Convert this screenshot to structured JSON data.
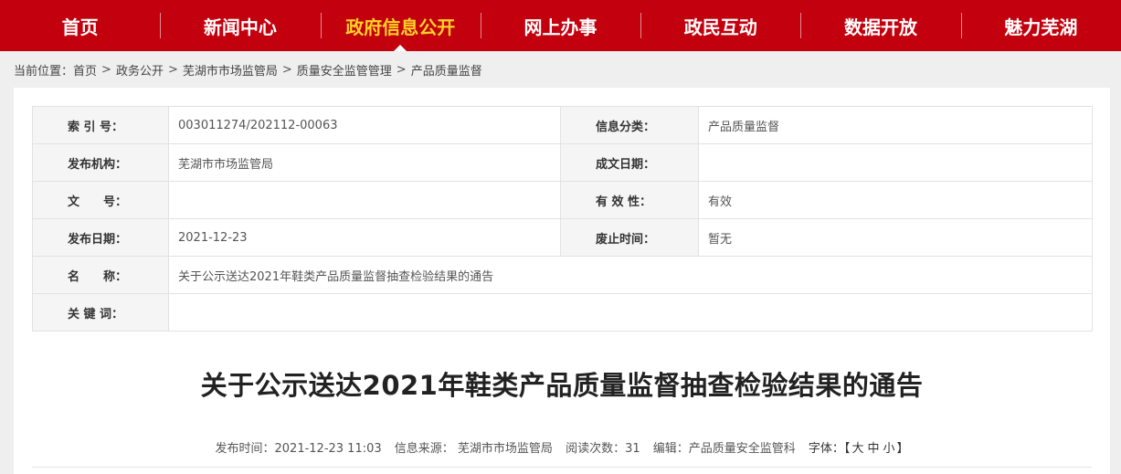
{
  "nav": {
    "items": [
      {
        "label": "首页",
        "active": false
      },
      {
        "label": "新闻中心",
        "active": false
      },
      {
        "label": "政府信息公开",
        "active": true
      },
      {
        "label": "网上办事",
        "active": false
      },
      {
        "label": "政民互动",
        "active": false
      },
      {
        "label": "数据开放",
        "active": false
      },
      {
        "label": "魅力芜湖",
        "active": false
      }
    ]
  },
  "breadcrumb": {
    "prefix": "当前位置：",
    "separator": ">",
    "items": [
      "首页",
      "政务公开",
      "芜湖市市场监管局",
      "质量安全监管管理",
      "产品质量监督"
    ]
  },
  "info": {
    "index_label": "索 引 号：",
    "index_value": "003011274/202112-00063",
    "category_label": "信息分类：",
    "category_value": "产品质量监督",
    "publisher_label": "发布机构：",
    "publisher_value": "芜湖市市场监管局",
    "written_date_label": "成文日期：",
    "written_date_value": "",
    "doc_no_label": "文　　号：",
    "doc_no_value": "",
    "validity_label": "有 效 性：",
    "validity_value": "有效",
    "publish_date_label": "发布日期：",
    "publish_date_value": "2021-12-23",
    "expiry_label": "废止时间：",
    "expiry_value": "暂无",
    "name_label": "名　　称：",
    "name_value": "关于公示送达2021年鞋类产品质量监督抽查检验结果的通告",
    "keywords_label": "关 键 词：",
    "keywords_value": ""
  },
  "article": {
    "title": "关于公示送达2021年鞋类产品质量监督抽查检验结果的通告",
    "publish_time": "发布时间：2021-12-23 11:03",
    "source": "信息来源： 芜湖市市场监管局",
    "reads": "阅读次数：31",
    "editor": "编辑：产品质量安全监管科",
    "font_label": "字体：【",
    "font_large": "大",
    "font_medium": "中",
    "font_small": "小",
    "font_close": "】"
  },
  "colors": {
    "nav_bg": "#c3000d",
    "nav_active_text": "#ffd227"
  }
}
